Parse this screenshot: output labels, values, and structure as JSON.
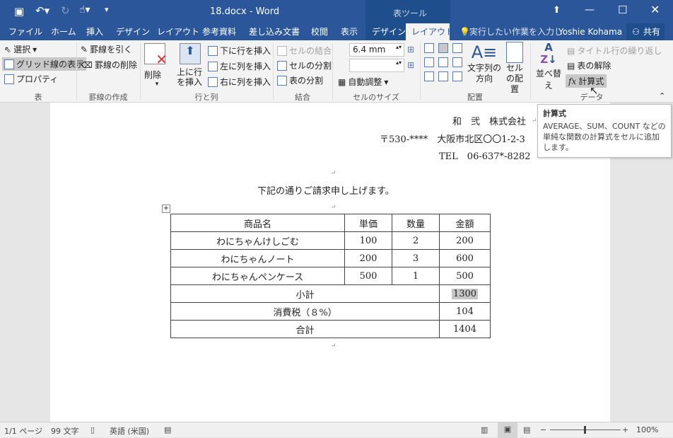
{
  "title": "18.docx - Word",
  "context_tab_group": "表ツール",
  "tabs": [
    "ファイル",
    "ホーム",
    "挿入",
    "デザイン",
    "レイアウト",
    "参考資料",
    "差し込み文書",
    "校閲",
    "表示",
    "デザイン",
    "レイアウト"
  ],
  "active_tab": "レイアウト",
  "tell_me": "実行したい作業を入力し",
  "user": "Yoshie Kohama",
  "share": "共有",
  "ribbon": {
    "table": {
      "select": "選択",
      "gridlines": "グリッド線の表示",
      "properties": "プロパティ",
      "group": "表"
    },
    "draw": {
      "draw_table": "罫線を引く",
      "eraser": "罫線の削除",
      "group": "罫線の作成"
    },
    "rows_cols": {
      "delete": "削除",
      "insert_above": "上に行を挿入",
      "insert_below": "下に行を挿入",
      "insert_left": "左に列を挿入",
      "insert_right": "右に列を挿入",
      "group": "行と列"
    },
    "merge": {
      "merge_cells": "セルの結合",
      "split_cells": "セルの分割",
      "split_table": "表の分割",
      "group": "結合"
    },
    "cell_size": {
      "height": "6.4 mm",
      "width": "",
      "autofit": "自動調整",
      "group": "セルのサイズ"
    },
    "alignment": {
      "text_direction": "文字列の方向",
      "cell_margins": "セルの配置",
      "group": "配置"
    },
    "data": {
      "sort": "並べ替え",
      "repeat_header": "タイトル行の繰り返し",
      "convert": "表の解除",
      "formula": "計算式",
      "group": "データ"
    }
  },
  "tooltip": {
    "title": "計算式",
    "body": "AVERAGE、SUM、COUNT などの単純な関数の計算式をセルに追加します。"
  },
  "document": {
    "company": "和　弐　株式会社",
    "address": "〒530-****　大阪市北区〇〇1-2-3",
    "tel": "TEL　06-637*-8282",
    "intro": "下記の通りご請求申し上げます。",
    "table": {
      "headers": [
        "商品名",
        "単価",
        "数量",
        "金額"
      ],
      "rows": [
        [
          "わにちゃんけしごむ",
          "100",
          "2",
          "200"
        ],
        [
          "わにちゃんノート",
          "200",
          "3",
          "600"
        ],
        [
          "わにちゃんペンケース",
          "500",
          "1",
          "500"
        ]
      ],
      "subtotal": [
        "小計",
        "1300"
      ],
      "tax": [
        "消費税（８%）",
        "104"
      ],
      "total": [
        "合計",
        "1404"
      ]
    }
  },
  "status": {
    "page": "1/1 ページ",
    "words": "99 文字",
    "language": "英語 (米国)",
    "zoom": "100%"
  },
  "colors": {
    "accent": "#2b579a"
  }
}
